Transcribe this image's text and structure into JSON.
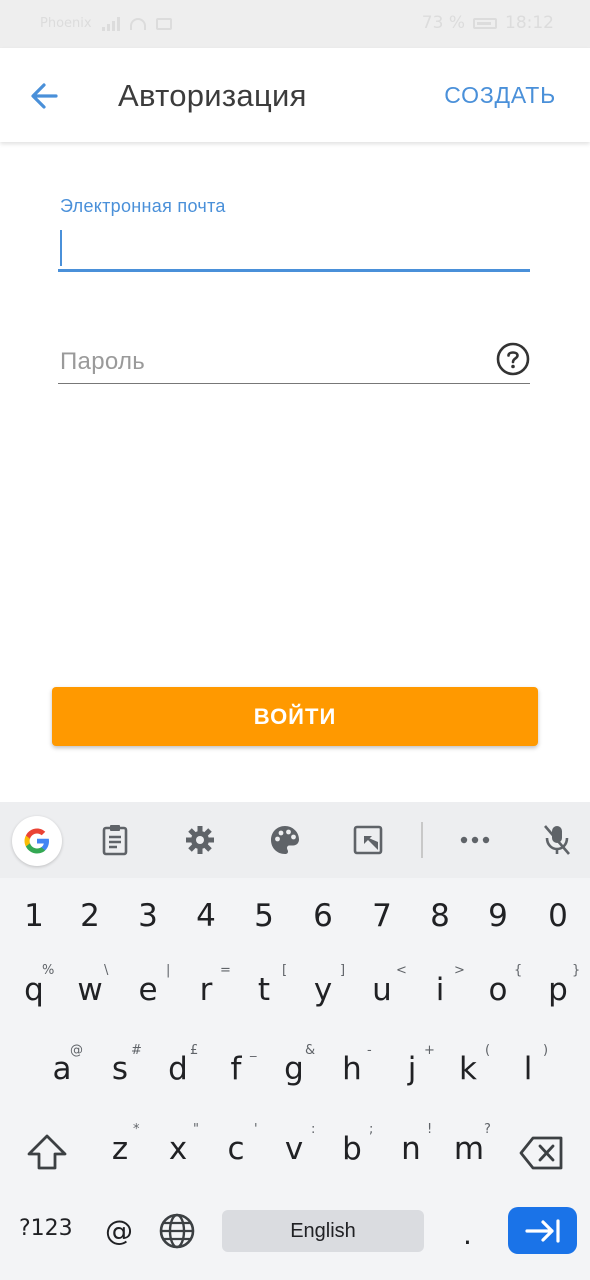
{
  "status_bar": {
    "carrier": "Phoenix",
    "battery": "73 %",
    "time": "18:12"
  },
  "app_bar": {
    "title": "Авторизация",
    "create_label": "СОЗДАТЬ"
  },
  "form": {
    "email_label": "Электронная почта",
    "email_value": "",
    "password_placeholder": "Пароль",
    "login_label": "ВОЙТИ"
  },
  "keyboard": {
    "number_row": [
      "1",
      "2",
      "3",
      "4",
      "5",
      "6",
      "7",
      "8",
      "9",
      "0"
    ],
    "row1": [
      "q",
      "w",
      "e",
      "r",
      "t",
      "y",
      "u",
      "i",
      "o",
      "p"
    ],
    "row1_hints": [
      "%",
      "\\",
      "|",
      "=",
      "[",
      "]",
      "<",
      ">",
      "{",
      "}"
    ],
    "row2": [
      "a",
      "s",
      "d",
      "f",
      "g",
      "h",
      "j",
      "k",
      "l"
    ],
    "row2_hints": [
      "@",
      "#",
      "£",
      "_",
      "&",
      "-",
      "+",
      "(",
      ")"
    ],
    "row3": [
      "z",
      "x",
      "c",
      "v",
      "b",
      "n",
      "m"
    ],
    "row3_hints": [
      "*",
      "\"",
      "'",
      ":",
      ";",
      "!",
      "?"
    ],
    "symbols_label": "?123",
    "at_key": "@",
    "space_label": "English",
    "period_key": "."
  },
  "colors": {
    "accent": "#4a90d9",
    "button": "#ff9900",
    "enter_key": "#1a73e8"
  }
}
